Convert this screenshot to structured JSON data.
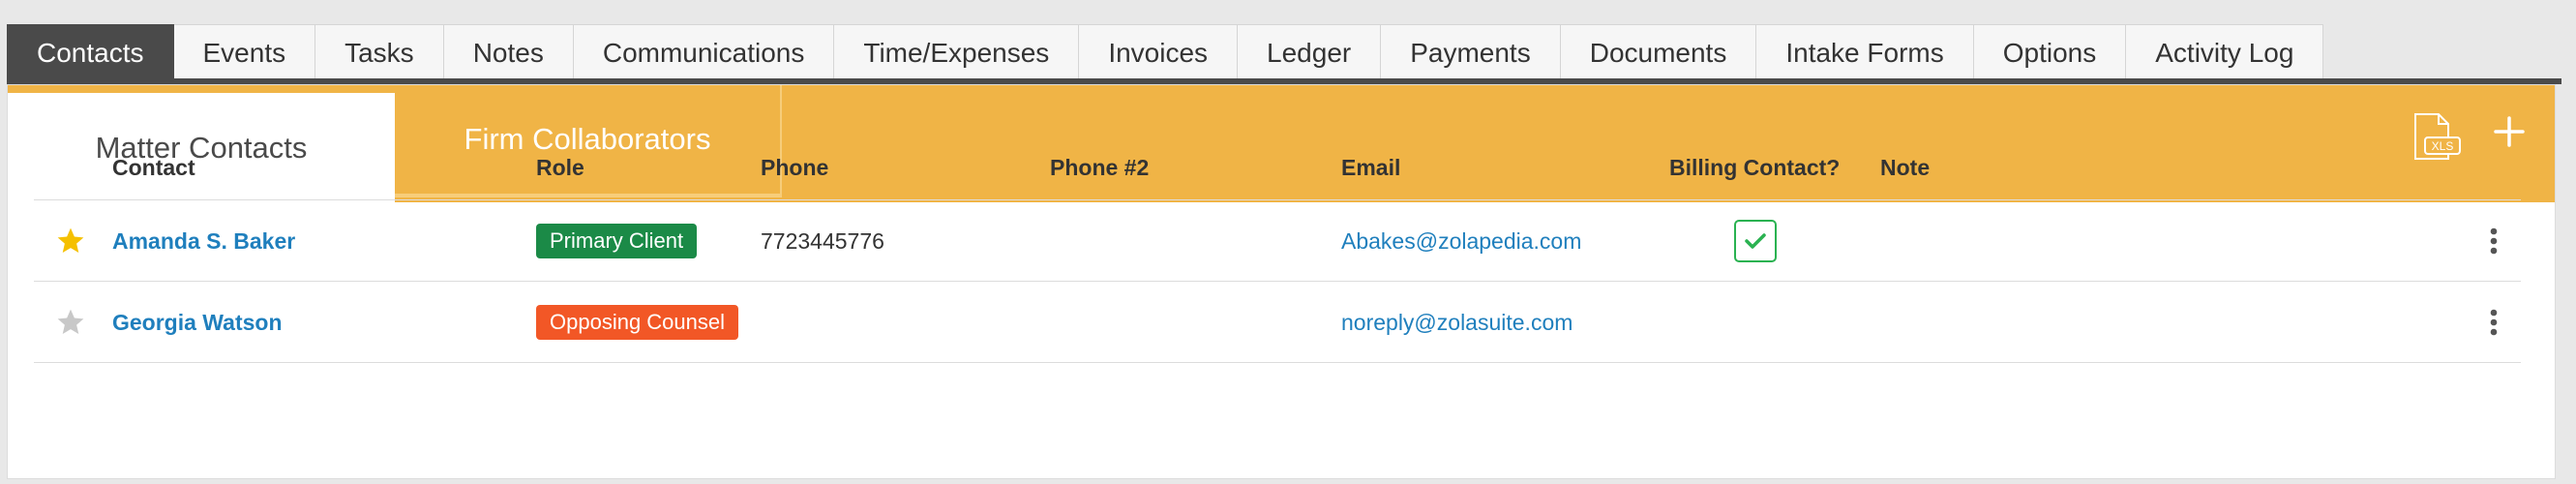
{
  "tabs": [
    {
      "label": "Contacts",
      "active": true
    },
    {
      "label": "Events"
    },
    {
      "label": "Tasks"
    },
    {
      "label": "Notes"
    },
    {
      "label": "Communications"
    },
    {
      "label": "Time/Expenses"
    },
    {
      "label": "Invoices"
    },
    {
      "label": "Ledger"
    },
    {
      "label": "Payments"
    },
    {
      "label": "Documents"
    },
    {
      "label": "Intake Forms"
    },
    {
      "label": "Options"
    },
    {
      "label": "Activity Log"
    }
  ],
  "subtabs": {
    "matter": "Matter Contacts",
    "firm": "Firm Collaborators"
  },
  "toolbar": {
    "export_icon": "xls-export-icon",
    "add_icon": "plus-icon",
    "xls_text": "XLS"
  },
  "table": {
    "columns": [
      "Contact",
      "Role",
      "Phone",
      "Phone #2",
      "Email",
      "Billing Contact?",
      "Note"
    ],
    "rows": [
      {
        "starred": true,
        "contact": "Amanda S. Baker",
        "role": "Primary Client",
        "phone": "7723445776",
        "phone2": "",
        "email": "Abakes@zolapedia.com",
        "billing": true,
        "note": ""
      },
      {
        "starred": false,
        "contact": "Georgia Watson",
        "role": "Opposing Counsel",
        "phone": "",
        "phone2": "",
        "email": "noreply@zolasuite.com",
        "billing": false,
        "note": ""
      }
    ]
  },
  "colors": {
    "accent": "#f0b446",
    "active_tab": "#4a4a4a",
    "link": "#1f7fbd",
    "role_primary": "#1b8a47",
    "role_opposing": "#f25726",
    "star_on": "#f5c000",
    "star_off": "#c8c8c8",
    "check": "#2ab251"
  }
}
